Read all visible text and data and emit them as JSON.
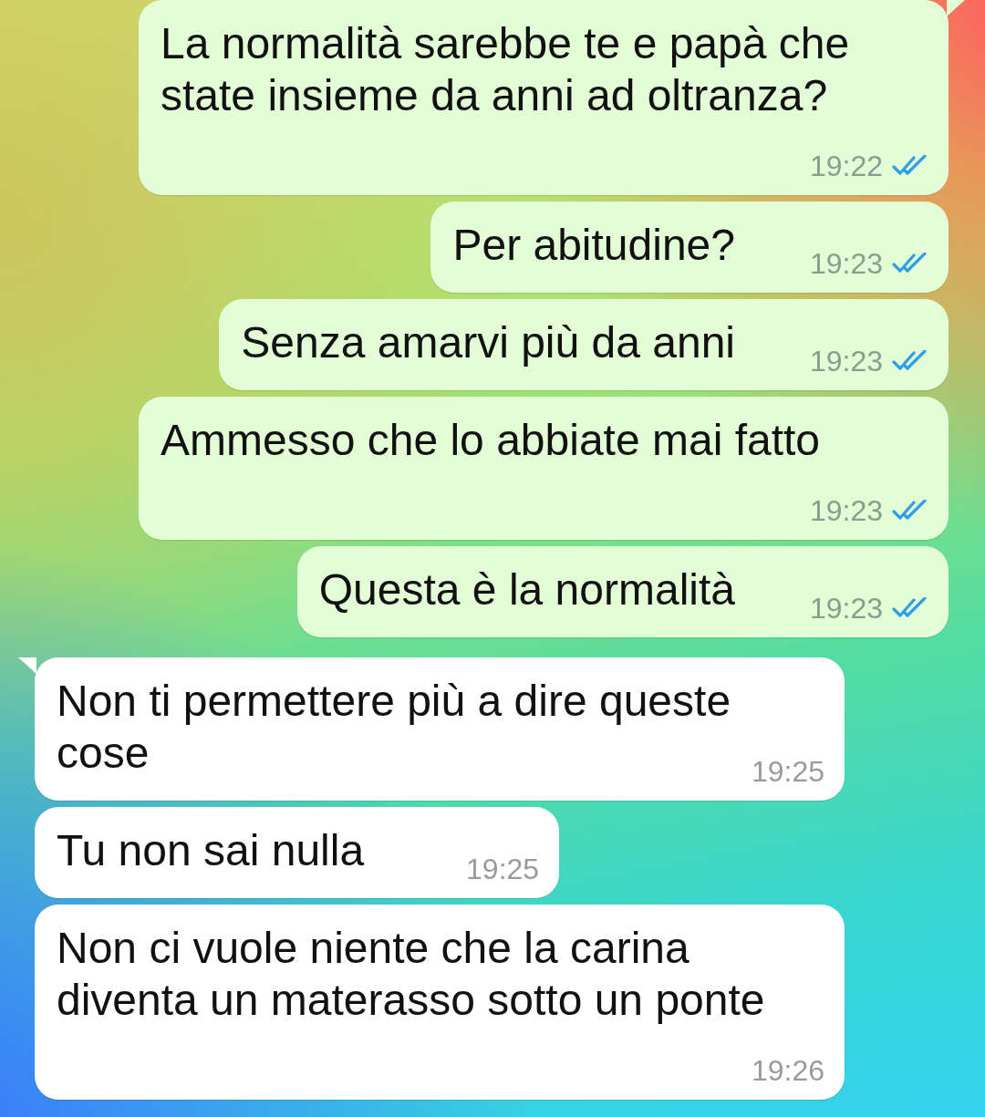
{
  "messages": [
    {
      "kind": "outgoing",
      "text": "La normalità sarebbe te e papà che state insieme da anni ad oltranza?",
      "time": "19:22",
      "read": true,
      "tail": true
    },
    {
      "kind": "outgoing",
      "text": "Per abitudine?",
      "time": "19:23",
      "read": true,
      "tail": false
    },
    {
      "kind": "outgoing",
      "text": "Senza amarvi più da anni",
      "time": "19:23",
      "read": true,
      "tail": false
    },
    {
      "kind": "outgoing",
      "text": "Ammesso che lo abbiate mai fatto",
      "time": "19:23",
      "read": true,
      "tail": false
    },
    {
      "kind": "outgoing",
      "text": "Questa è la normalità",
      "time": "19:23",
      "read": true,
      "tail": false
    },
    {
      "kind": "incoming",
      "text": "Non ti permettere più a dire queste cose",
      "time": "19:25",
      "tail": true
    },
    {
      "kind": "incoming",
      "text": "Tu non sai nulla",
      "time": "19:25",
      "tail": false
    },
    {
      "kind": "incoming",
      "text": "Non ci vuole niente che la carina diventa un materasso sotto un ponte",
      "time": "19:26",
      "tail": false
    }
  ]
}
